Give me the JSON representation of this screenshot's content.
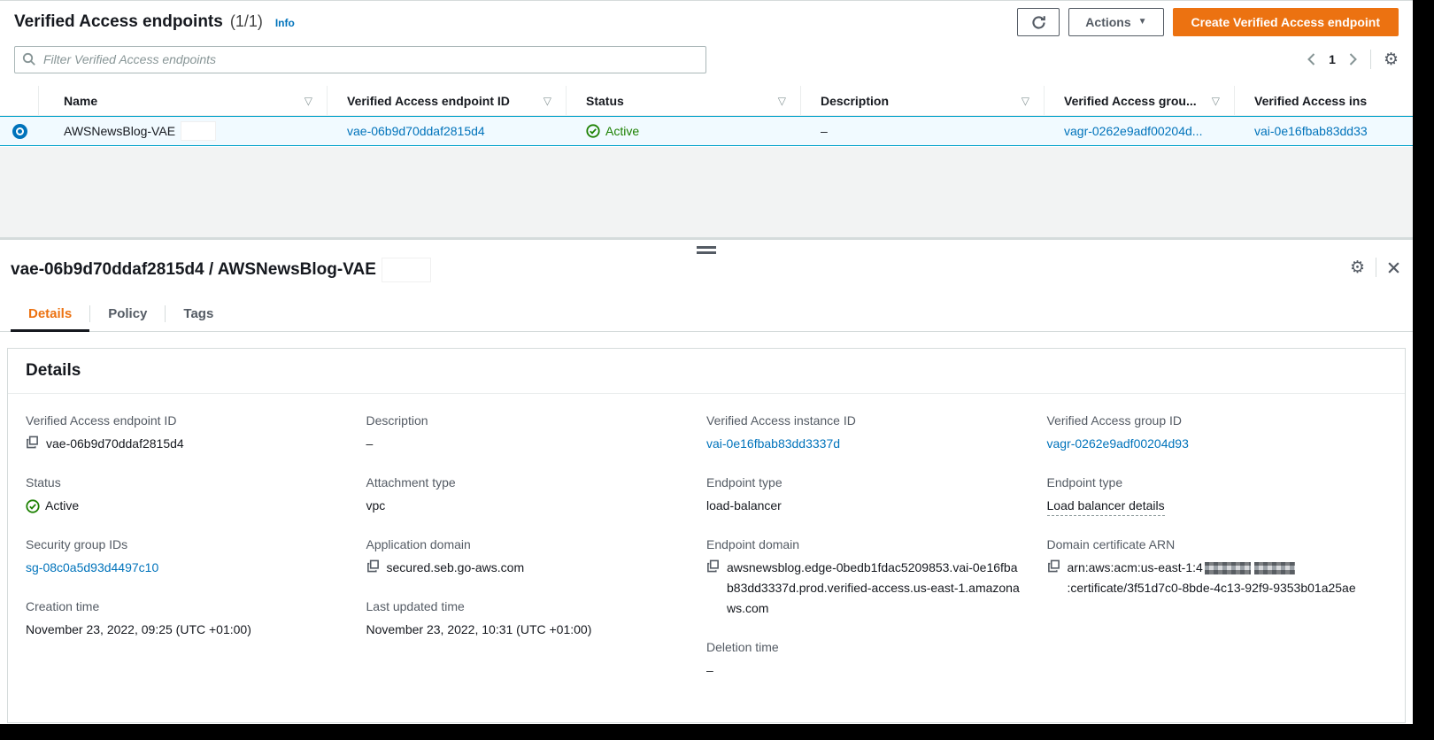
{
  "colors": {
    "accent_orange": "#ec7211",
    "link_blue": "#0073bb",
    "status_green": "#1d8102",
    "selected_row_border": "#00a1c9"
  },
  "icons": {
    "caret_down": "▼",
    "filter_glyph": "▽",
    "gear_glyph": "⚙"
  },
  "header": {
    "title": "Verified Access endpoints",
    "count": "(1/1)",
    "info": "Info",
    "actions": "Actions",
    "create": "Create Verified Access endpoint"
  },
  "filter": {
    "placeholder": "Filter Verified Access endpoints"
  },
  "pagination": {
    "page": "1"
  },
  "table": {
    "headers": {
      "name": "Name",
      "endpoint_id": "Verified Access endpoint ID",
      "status": "Status",
      "description": "Description",
      "group": "Verified Access grou...",
      "instance": "Verified Access ins"
    },
    "row": {
      "name": "AWSNewsBlog-VAE",
      "endpoint_id": "vae-06b9d70ddaf2815d4",
      "status": "Active",
      "description": "–",
      "group": "vagr-0262e9adf00204d...",
      "instance": "vai-0e16fbab83dd33"
    }
  },
  "panel": {
    "title": "vae-06b9d70ddaf2815d4 / AWSNewsBlog-VAE",
    "tabs": {
      "details": "Details",
      "policy": "Policy",
      "tags": "Tags"
    },
    "card_title": "Details",
    "f": {
      "endpoint_id": {
        "label": "Verified Access endpoint ID",
        "value": "vae-06b9d70ddaf2815d4"
      },
      "status": {
        "label": "Status",
        "value": "Active"
      },
      "sg": {
        "label": "Security group IDs",
        "value": "sg-08c0a5d93d4497c10"
      },
      "created": {
        "label": "Creation time",
        "value": "November 23, 2022, 09:25 (UTC +01:00)"
      },
      "description": {
        "label": "Description",
        "value": "–"
      },
      "attachment": {
        "label": "Attachment type",
        "value": "vpc"
      },
      "app_domain": {
        "label": "Application domain",
        "value": "secured.seb.go-aws.com"
      },
      "updated": {
        "label": "Last updated time",
        "value": "November 23, 2022, 10:31 (UTC +01:00)"
      },
      "instance": {
        "label": "Verified Access instance ID",
        "value": "vai-0e16fbab83dd3337d"
      },
      "ep_type": {
        "label": "Endpoint type",
        "value": "load-balancer"
      },
      "ep_domain": {
        "label": "Endpoint domain",
        "value": "awsnewsblog.edge-0bedb1fdac5209853.vai-0e16fbab83dd3337d.prod.verified-access.us-east-1.amazonaws.com"
      },
      "deletion": {
        "label": "Deletion time",
        "value": "–"
      },
      "group": {
        "label": "Verified Access group ID",
        "value": "vagr-0262e9adf00204d93"
      },
      "lb": {
        "label": "Endpoint type",
        "value": "Load balancer details"
      },
      "arn": {
        "label": "Domain certificate ARN",
        "prefix": "arn:aws:acm:us-east-1:4",
        "suffix": ":certificate/3f51d7c0-8bde-4c13-92f9-9353b01a25ae"
      }
    }
  }
}
